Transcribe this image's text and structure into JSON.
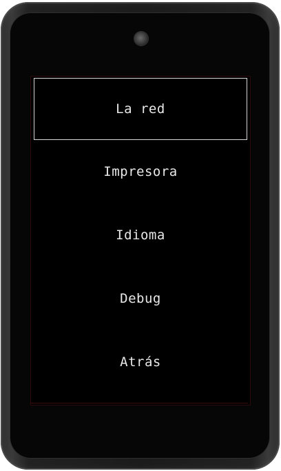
{
  "menu": {
    "items": [
      {
        "label": "La red",
        "selected": true
      },
      {
        "label": "Impresora",
        "selected": false
      },
      {
        "label": "Idioma",
        "selected": false
      },
      {
        "label": "Debug",
        "selected": false
      },
      {
        "label": "Atrás",
        "selected": false
      }
    ]
  },
  "device": {
    "camera_icon": "camera-lens-icon",
    "colors": {
      "screen_background": "#000000",
      "text": "#e8e8e8",
      "selection_border": "#d8d8d8",
      "bezel": "#1c1c1c"
    }
  }
}
